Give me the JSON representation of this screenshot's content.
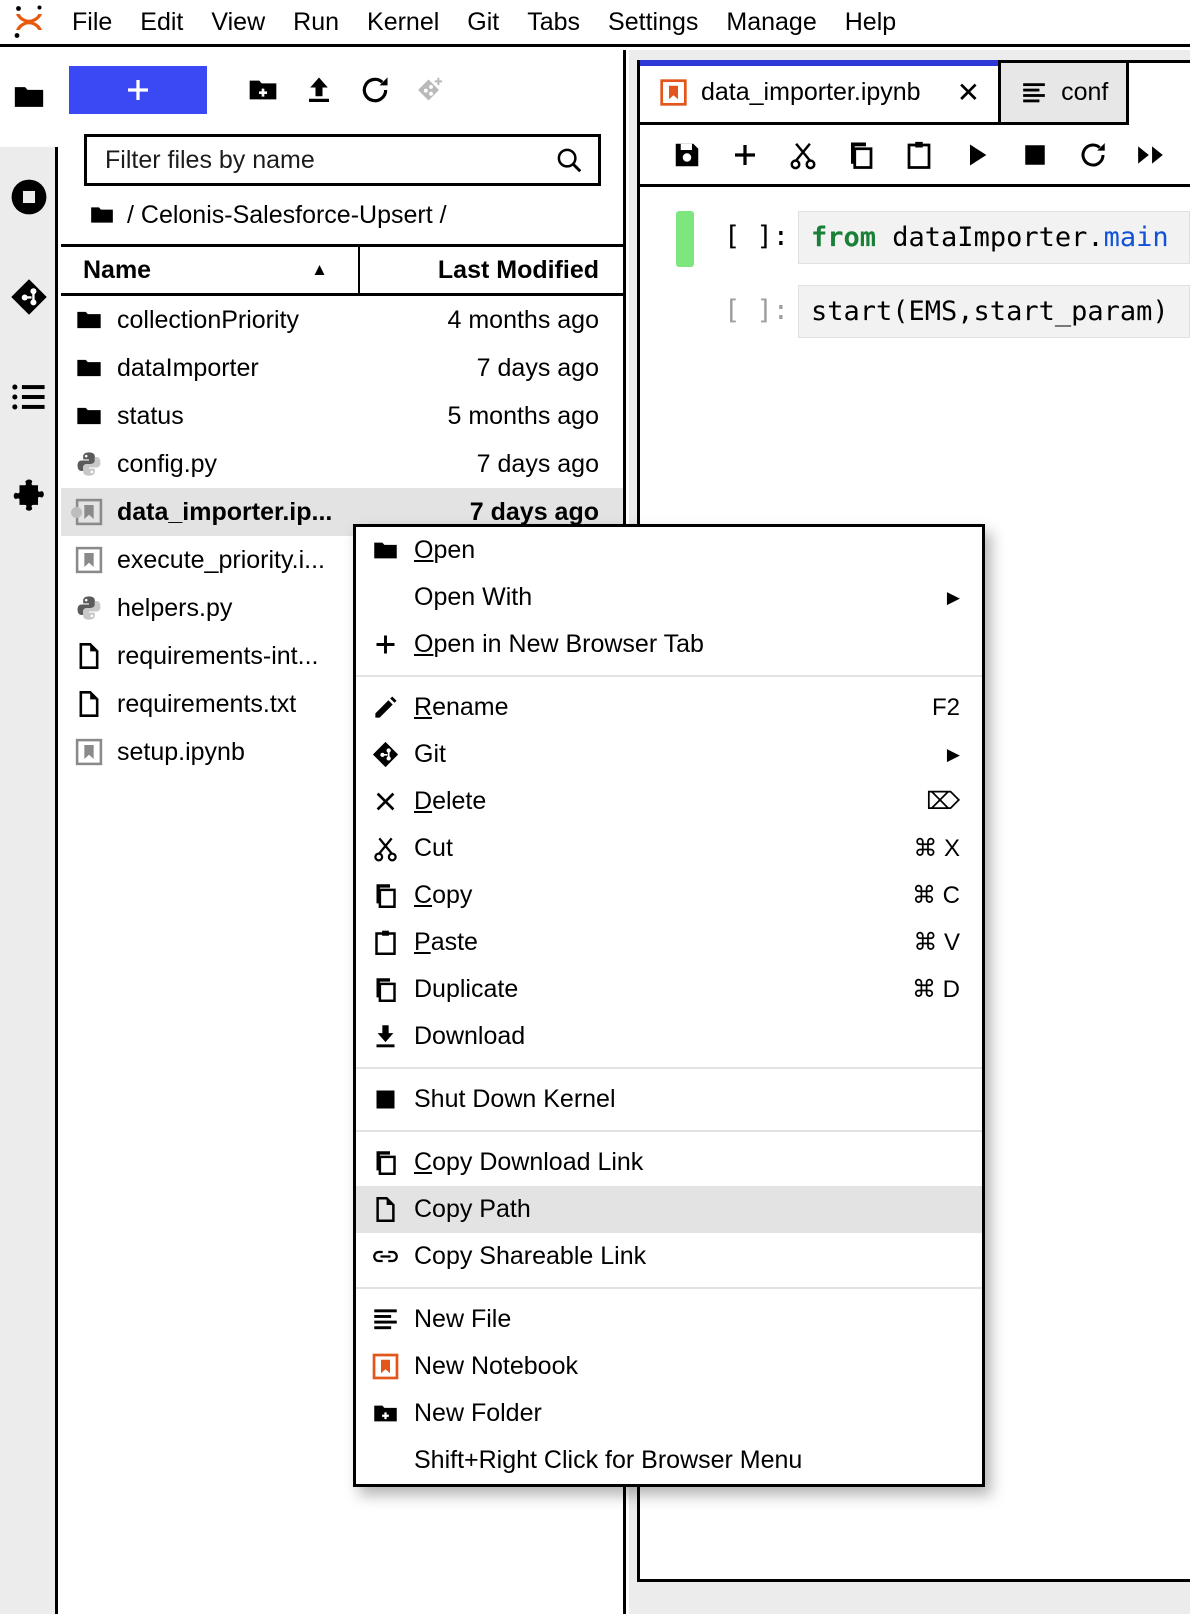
{
  "app": {
    "logo_icon": "jupyter-logo"
  },
  "menubar": {
    "items": [
      {
        "label": "File"
      },
      {
        "label": "Edit"
      },
      {
        "label": "View"
      },
      {
        "label": "Run"
      },
      {
        "label": "Kernel"
      },
      {
        "label": "Git"
      },
      {
        "label": "Tabs"
      },
      {
        "label": "Settings"
      },
      {
        "label": "Manage"
      },
      {
        "label": "Help"
      }
    ]
  },
  "activitybar": {
    "items": [
      {
        "name": "file-browser",
        "icon": "folder-icon",
        "active": true
      },
      {
        "name": "running-kernels",
        "icon": "stop-circle-icon",
        "active": false
      },
      {
        "name": "git-panel",
        "icon": "git-icon",
        "active": false
      },
      {
        "name": "table-of-contents",
        "icon": "list-icon",
        "active": false
      },
      {
        "name": "extension-manager",
        "icon": "puzzle-icon",
        "active": false
      }
    ]
  },
  "filebrowser": {
    "toolbar": {
      "new_launcher_label": "+",
      "new_folder_icon": "new-folder-icon",
      "upload_icon": "upload-icon",
      "refresh_icon": "refresh-icon",
      "new_git_repo_icon": "git-add-icon"
    },
    "filter": {
      "placeholder": "Filter files by name",
      "value": "",
      "search_icon": "search-icon"
    },
    "breadcrumb": {
      "root_icon": "folder-icon",
      "path": "/ Celonis-Salesforce-Upsert /"
    },
    "columns": {
      "name": "Name",
      "last_modified": "Last Modified",
      "sort_icon": "sort-ascending-icon"
    },
    "rows": [
      {
        "icon": "folder-icon",
        "name": "collectionPriority",
        "modified": "4 months ago",
        "selected": false,
        "running": false
      },
      {
        "icon": "folder-icon",
        "name": "dataImporter",
        "modified": "7 days ago",
        "selected": false,
        "running": false
      },
      {
        "icon": "folder-icon",
        "name": "status",
        "modified": "5 months ago",
        "selected": false,
        "running": false
      },
      {
        "icon": "python-icon",
        "name": "config.py",
        "modified": "7 days ago",
        "selected": false,
        "running": false
      },
      {
        "icon": "notebook-icon",
        "name": "data_importer.ip...",
        "modified": "7 days ago",
        "selected": true,
        "running": true
      },
      {
        "icon": "notebook-icon",
        "name": "execute_priority.i...",
        "modified": "",
        "selected": false,
        "running": false
      },
      {
        "icon": "python-icon",
        "name": "helpers.py",
        "modified": "",
        "selected": false,
        "running": false
      },
      {
        "icon": "file-icon",
        "name": "requirements-int...",
        "modified": "",
        "selected": false,
        "running": false
      },
      {
        "icon": "file-icon",
        "name": "requirements.txt",
        "modified": "",
        "selected": false,
        "running": false
      },
      {
        "icon": "notebook-icon",
        "name": "setup.ipynb",
        "modified": "",
        "selected": false,
        "running": false
      }
    ]
  },
  "dock": {
    "tabs": [
      {
        "label": "data_importer.ipynb",
        "icon": "notebook-icon",
        "current": true,
        "close_icon": "close-icon"
      },
      {
        "label": "conf",
        "icon": "text-file-icon",
        "current": false,
        "close_icon": ""
      }
    ],
    "toolbar": [
      {
        "name": "save-button",
        "icon": "save-icon"
      },
      {
        "name": "insert-cell-button",
        "icon": "plus-icon"
      },
      {
        "name": "cut-cell-button",
        "icon": "scissors-icon"
      },
      {
        "name": "copy-cell-button",
        "icon": "copy-icon"
      },
      {
        "name": "paste-cell-button",
        "icon": "paste-icon"
      },
      {
        "name": "run-cell-button",
        "icon": "play-icon"
      },
      {
        "name": "interrupt-button",
        "icon": "stop-icon"
      },
      {
        "name": "restart-button",
        "icon": "restart-icon"
      },
      {
        "name": "restart-run-all-button",
        "icon": "fast-forward-icon"
      }
    ],
    "cells": [
      {
        "prompt": "[ ]:",
        "active": true,
        "code_plain": "from dataImporter.main",
        "code_tokens": [
          {
            "t": "from",
            "c": "kw"
          },
          {
            "t": " dataImporter.",
            "c": ""
          },
          {
            "t": "main",
            "c": "mod"
          }
        ]
      },
      {
        "prompt": "[ ]:",
        "active": false,
        "code_plain": "start(EMS,start_param)",
        "code_tokens": [
          {
            "t": "start(EMS,start_param)",
            "c": ""
          }
        ]
      }
    ]
  },
  "context_menu": {
    "groups": [
      {
        "items": [
          {
            "icon": "folder-icon",
            "label": "Open",
            "mnemonic": "O",
            "shortcut": "",
            "submenu": false,
            "highlight": false
          },
          {
            "icon": "",
            "label": "Open With",
            "mnemonic": "",
            "shortcut": "",
            "submenu": true,
            "highlight": false
          },
          {
            "icon": "plus-icon",
            "label": "Open in New Browser Tab",
            "mnemonic": "O",
            "shortcut": "",
            "submenu": false,
            "highlight": false
          }
        ]
      },
      {
        "items": [
          {
            "icon": "pencil-icon",
            "label": "Rename",
            "mnemonic": "R",
            "shortcut": "F2",
            "submenu": false,
            "highlight": false
          },
          {
            "icon": "git-icon",
            "label": "Git",
            "mnemonic": "",
            "shortcut": "",
            "submenu": true,
            "highlight": false
          },
          {
            "icon": "close-icon",
            "label": "Delete",
            "mnemonic": "D",
            "shortcut": "⌦",
            "submenu": false,
            "highlight": false
          },
          {
            "icon": "scissors-icon",
            "label": "Cut",
            "mnemonic": "",
            "shortcut": "⌘ X",
            "submenu": false,
            "highlight": false
          },
          {
            "icon": "copy-icon",
            "label": "Copy",
            "mnemonic": "C",
            "shortcut": "⌘ C",
            "submenu": false,
            "highlight": false
          },
          {
            "icon": "paste-icon",
            "label": "Paste",
            "mnemonic": "P",
            "shortcut": "⌘ V",
            "submenu": false,
            "highlight": false
          },
          {
            "icon": "copy-icon",
            "label": "Duplicate",
            "mnemonic": "",
            "shortcut": "⌘ D",
            "submenu": false,
            "highlight": false
          },
          {
            "icon": "download-icon",
            "label": "Download",
            "mnemonic": "",
            "shortcut": "",
            "submenu": false,
            "highlight": false
          }
        ]
      },
      {
        "items": [
          {
            "icon": "stop-icon",
            "label": "Shut Down Kernel",
            "mnemonic": "",
            "shortcut": "",
            "submenu": false,
            "highlight": false
          }
        ]
      },
      {
        "items": [
          {
            "icon": "copy-icon",
            "label": "Copy Download Link",
            "mnemonic": "C",
            "shortcut": "",
            "submenu": false,
            "highlight": false
          },
          {
            "icon": "file-icon",
            "label": "Copy Path",
            "mnemonic": "",
            "shortcut": "",
            "submenu": false,
            "highlight": true
          },
          {
            "icon": "link-icon",
            "label": "Copy Shareable Link",
            "mnemonic": "",
            "shortcut": "",
            "submenu": false,
            "highlight": false
          }
        ]
      },
      {
        "items": [
          {
            "icon": "text-file-icon",
            "label": "New File",
            "mnemonic": "",
            "shortcut": "",
            "submenu": false,
            "highlight": false
          },
          {
            "icon": "notebook-icon",
            "label": "New Notebook",
            "mnemonic": "",
            "shortcut": "",
            "submenu": false,
            "highlight": false
          },
          {
            "icon": "new-folder-icon",
            "label": "New Folder",
            "mnemonic": "",
            "shortcut": "",
            "submenu": false,
            "highlight": false
          },
          {
            "icon": "",
            "label": "Shift+Right Click for Browser Menu",
            "mnemonic": "",
            "shortcut": "",
            "submenu": false,
            "highlight": false
          }
        ]
      }
    ]
  },
  "colors": {
    "accent_blue": "#3b49f5",
    "tab_underline": "#2f37d6",
    "notebook_orange": "#e2561b",
    "cell_active_green": "#7ee67e",
    "selection_gray": "#e3e3e3",
    "chrome_gray": "#ececec",
    "code_keyword": "#1a7f37",
    "code_module": "#1152d6"
  }
}
